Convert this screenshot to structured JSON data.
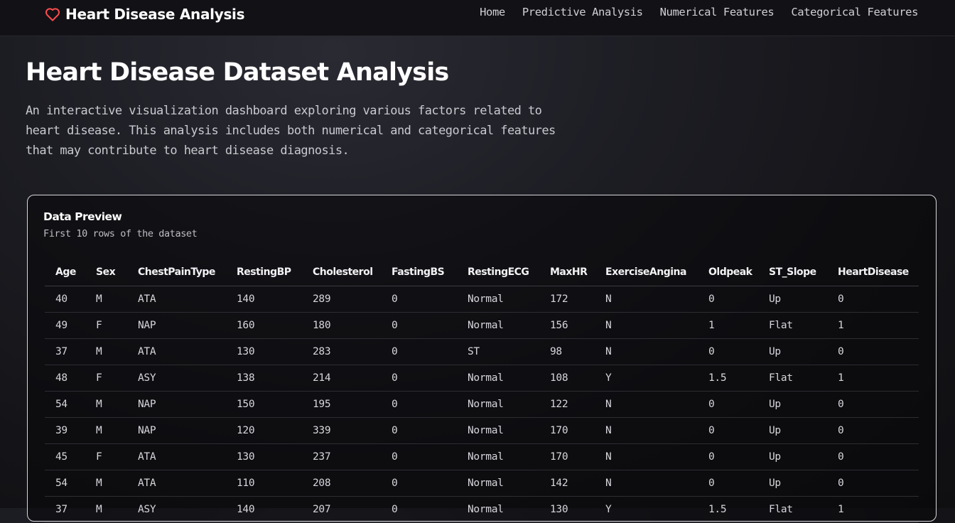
{
  "nav": {
    "brand": "Heart Disease Analysis",
    "brand_icon": "heart-outline-icon",
    "accent_color": "#ff4d4d",
    "links": [
      "Home",
      "Predictive Analysis",
      "Numerical Features",
      "Categorical Features"
    ]
  },
  "hero": {
    "title": "Heart Disease Dataset Analysis",
    "description": "An interactive visualization dashboard exploring various factors related to heart disease. This analysis includes both numerical and categorical features that may contribute to heart disease diagnosis."
  },
  "preview": {
    "title": "Data Preview",
    "subtitle": "First 10 rows of the dataset",
    "columns": [
      "Age",
      "Sex",
      "ChestPainType",
      "RestingBP",
      "Cholesterol",
      "FastingBS",
      "RestingECG",
      "MaxHR",
      "ExerciseAngina",
      "Oldpeak",
      "ST_Slope",
      "HeartDisease"
    ],
    "rows": [
      [
        "40",
        "M",
        "ATA",
        "140",
        "289",
        "0",
        "Normal",
        "172",
        "N",
        "0",
        "Up",
        "0"
      ],
      [
        "49",
        "F",
        "NAP",
        "160",
        "180",
        "0",
        "Normal",
        "156",
        "N",
        "1",
        "Flat",
        "1"
      ],
      [
        "37",
        "M",
        "ATA",
        "130",
        "283",
        "0",
        "ST",
        "98",
        "N",
        "0",
        "Up",
        "0"
      ],
      [
        "48",
        "F",
        "ASY",
        "138",
        "214",
        "0",
        "Normal",
        "108",
        "Y",
        "1.5",
        "Flat",
        "1"
      ],
      [
        "54",
        "M",
        "NAP",
        "150",
        "195",
        "0",
        "Normal",
        "122",
        "N",
        "0",
        "Up",
        "0"
      ],
      [
        "39",
        "M",
        "NAP",
        "120",
        "339",
        "0",
        "Normal",
        "170",
        "N",
        "0",
        "Up",
        "0"
      ],
      [
        "45",
        "F",
        "ATA",
        "130",
        "237",
        "0",
        "Normal",
        "170",
        "N",
        "0",
        "Up",
        "0"
      ],
      [
        "54",
        "M",
        "ATA",
        "110",
        "208",
        "0",
        "Normal",
        "142",
        "N",
        "0",
        "Up",
        "0"
      ],
      [
        "37",
        "M",
        "ASY",
        "140",
        "207",
        "0",
        "Normal",
        "130",
        "Y",
        "1.5",
        "Flat",
        "1"
      ]
    ]
  }
}
